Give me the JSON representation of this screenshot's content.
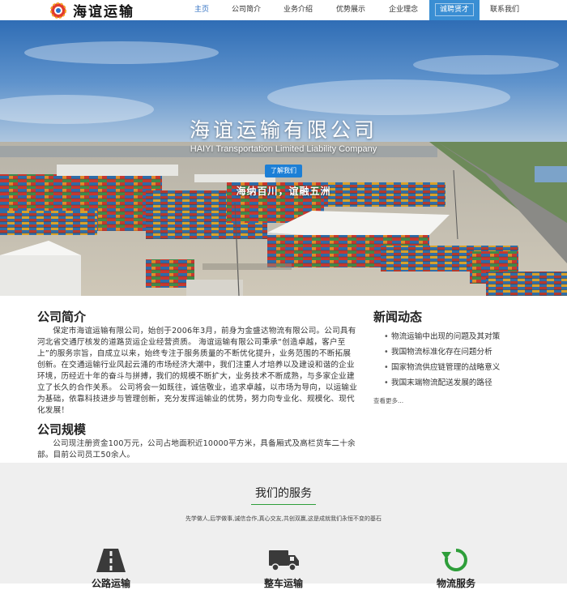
{
  "header": {
    "logo_text": "海谊运输",
    "nav": [
      "主页",
      "公司简介",
      "业务介绍",
      "优势展示",
      "企业理念",
      "诚聘贤才",
      "联系我们"
    ]
  },
  "hero": {
    "title": "海谊运输有限公司",
    "subtitle": "HAIYI Transportation Limited Liability Company",
    "button": "了解我们",
    "slogan": "海纳百川，谊融五洲"
  },
  "about": {
    "title": "公司简介",
    "text": "保定市海谊运输有限公司，始创于2006年3月，前身为金盛达物流有限公司。公司具有河北省交通厅核发的道路货运企业经营资质。 海谊运输有限公司秉承“创造卓越，客户至上”的服务宗旨，自成立以来，始终专注于服务质量的不断优化提升，业务范围的不断拓展创新。在交通运输行业风起云涌的市场经济大潮中，我们注重人才培养以及建设和谐的企业环境，历经近十年的奋斗与拼搏，我们的规模不断扩大，业务技术不断成熟，与多家企业建立了长久的合作关系。 公司将会一如既往，诚信敬业，追求卓越，以市场为导向，以运输业为基础，依靠科技进步与管理创新，充分发挥运输业的优势，努力向专业化、规模化、现代化发展！"
  },
  "scale": {
    "title": "公司规模",
    "text": "公司现注册资金100万元，公司占地面积近10000平方米，具备厢式及高栏货车二十余部。目前公司员工50余人。"
  },
  "news": {
    "title": "新闻动态",
    "items": [
      "物流运输中出现的问题及其对策",
      "我国物流标准化存在问题分析",
      "国家物流供应链管理的战略意义",
      "我国末端物流配送发展的路径"
    ],
    "more": "查看更多..."
  },
  "services": {
    "title": "我们的服务",
    "subtitle": "先学做人,后学做事,诚信合作,真心交友,共创双赢,这是成就我们永恒不变的基石",
    "items": [
      "公路运输",
      "整车运输",
      "物流服务"
    ]
  },
  "colors": {
    "accent": "#3a8ed3",
    "green": "#2e9e3a",
    "button": "#1c7fd6"
  }
}
